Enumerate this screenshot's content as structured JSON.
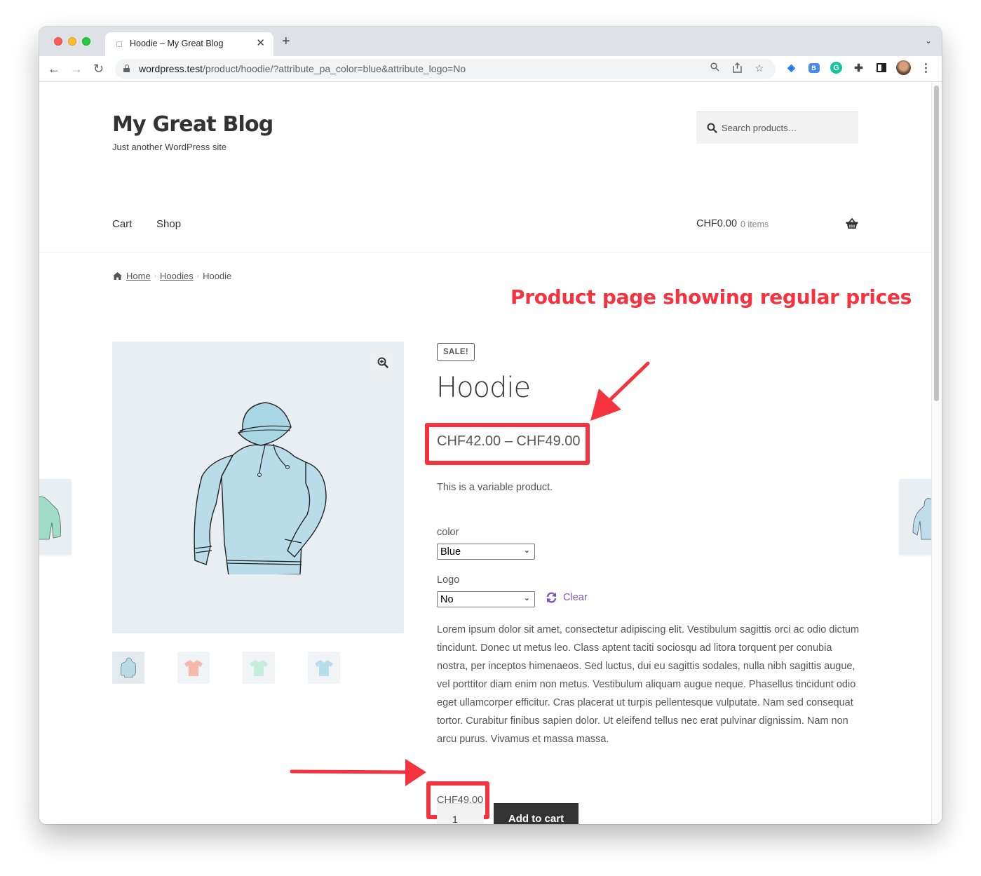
{
  "browser": {
    "tab_title": "Hoodie – My Great Blog",
    "url_host": "wordpress.test",
    "url_path": "/product/hoodie/?attribute_pa_color=blue&attribute_logo=No",
    "icons": [
      "back-arrow",
      "forward-arrow",
      "reload",
      "lock",
      "zoom",
      "share",
      "bookmark-star",
      "tag-extension",
      "b-extension",
      "grammarly-extension",
      "puzzle-extensions",
      "side-panel",
      "profile-avatar",
      "menu-kebab"
    ]
  },
  "site": {
    "title": "My Great Blog",
    "tagline": "Just another WordPress site",
    "search_placeholder": "Search products…",
    "nav": [
      {
        "label": "Cart"
      },
      {
        "label": "Shop"
      }
    ],
    "cart_total": "CHF0.00",
    "cart_count": "0 items"
  },
  "breadcrumb": {
    "items": [
      "Home",
      "Hoodies"
    ],
    "current": "Hoodie"
  },
  "annotation": {
    "text": "Product page showing regular prices",
    "color": "#f5333f"
  },
  "product": {
    "badge": "SALE!",
    "title": "Hoodie",
    "price_range": "CHF42.00 – CHF49.00",
    "short_description": "This is a variable product.",
    "attributes": [
      {
        "label": "color",
        "selected": "Blue"
      },
      {
        "label": "Logo",
        "selected": "No"
      }
    ],
    "clear_label": "Clear",
    "description": "Lorem ipsum dolor sit amet, consectetur adipiscing elit. Vestibulum sagittis orci ac odio dictum tincidunt. Donec ut metus leo. Class aptent taciti sociosqu ad litora torquent per conubia nostra, per inceptos himenaeos. Sed luctus, dui eu sagittis sodales, nulla nibh sagittis augue, vel porttitor diam enim non metus. Vestibulum aliquam augue neque. Phasellus tincidunt odio eget ullamcorper efficitur. Cras placerat ut turpis pellentesque vulputate. Nam sed consequat tortor. Curabitur finibus sapien dolor. Ut eleifend tellus nec erat pulvinar dignissim. Nam non arcu purus. Vivamus et massa massa.",
    "variation_price": "CHF49.00",
    "quantity": "1",
    "add_to_cart_label": "Add to cart",
    "thumbnails": [
      {
        "name": "hoodie-blue",
        "color": "#b9dbe6"
      },
      {
        "name": "tshirt-pink",
        "color": "#f5b8ab"
      },
      {
        "name": "tshirt-mint",
        "color": "#c6ecdc"
      },
      {
        "name": "tshirt-blue",
        "color": "#b7dcea"
      }
    ]
  }
}
